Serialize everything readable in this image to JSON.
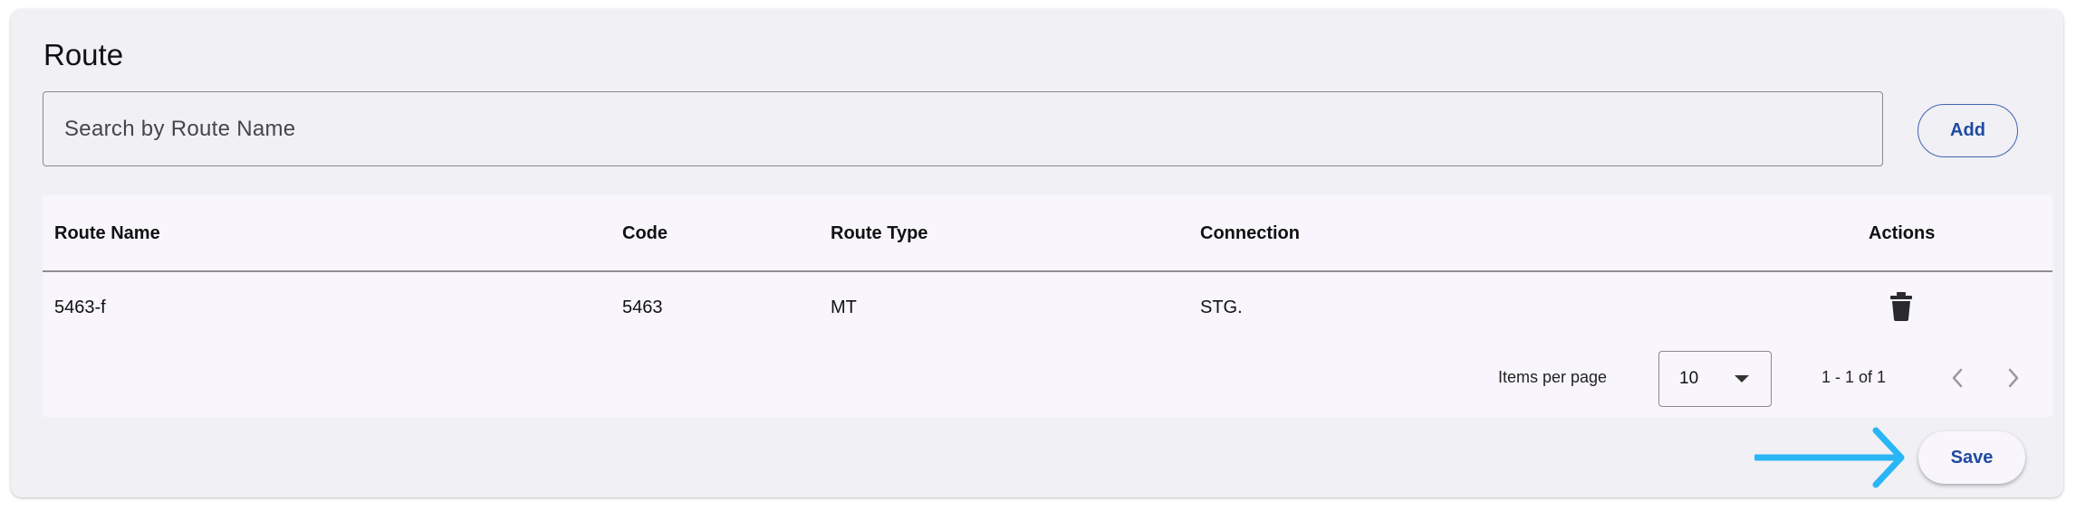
{
  "page": {
    "title": "Route"
  },
  "search": {
    "placeholder": "Search by Route Name",
    "value": ""
  },
  "add_button": {
    "label": "Add"
  },
  "table": {
    "columns": [
      "Route Name",
      "Code",
      "Route Type",
      "Connection",
      "Actions"
    ],
    "rows": [
      {
        "route_name": "5463-f",
        "code": "5463",
        "route_type": "MT",
        "connection": "STG."
      }
    ]
  },
  "pagination": {
    "items_per_page_label": "Items per page",
    "items_per_page_value": "10",
    "range_text": "1 - 1 of 1"
  },
  "save_button": {
    "label": "Save"
  },
  "colors": {
    "accent": "#1e4aa0",
    "arrow": "#29b6f6",
    "card_bg": "#f1f0f4",
    "table_bg": "#f8f6fc"
  },
  "icons": [
    "trash-icon",
    "caret-down-icon",
    "chevron-left-icon",
    "chevron-right-icon",
    "arrow-right-icon"
  ]
}
